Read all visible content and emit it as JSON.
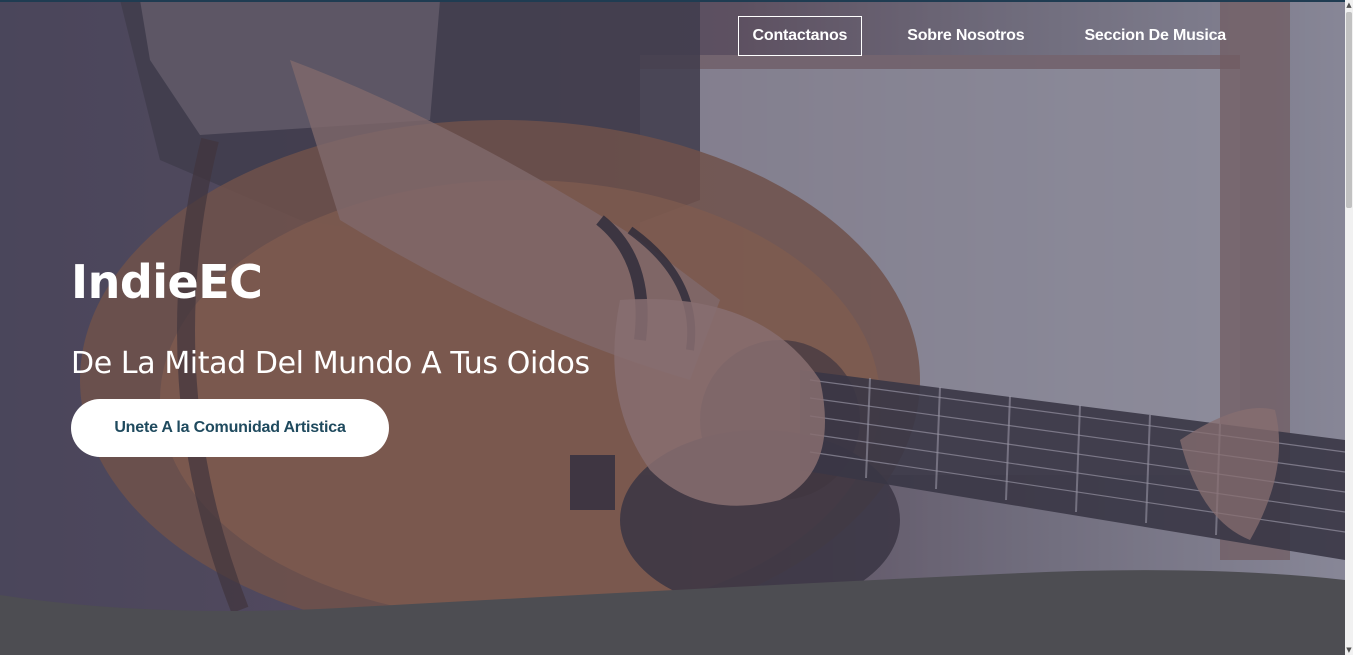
{
  "nav": {
    "items": [
      {
        "label": "Contactanos",
        "boxed": true
      },
      {
        "label": "Sobre Nosotros",
        "boxed": false
      },
      {
        "label": "Seccion De Musica",
        "boxed": false
      }
    ]
  },
  "hero": {
    "brand": "IndieEC",
    "tagline": "De La Mitad Del Mundo A Tus Oidos",
    "cta_label": "Unete A la Comunidad Artistica",
    "background_image": "guitar-player-photo"
  },
  "colors": {
    "overlay": "#4a4660",
    "cta_text": "#1f4a5e",
    "footer_band": "#4d4d52",
    "top_rule": "#1f3c52"
  },
  "scrollbar": {
    "up_icon": "chevron-up-icon",
    "down_icon": "chevron-down-icon"
  }
}
